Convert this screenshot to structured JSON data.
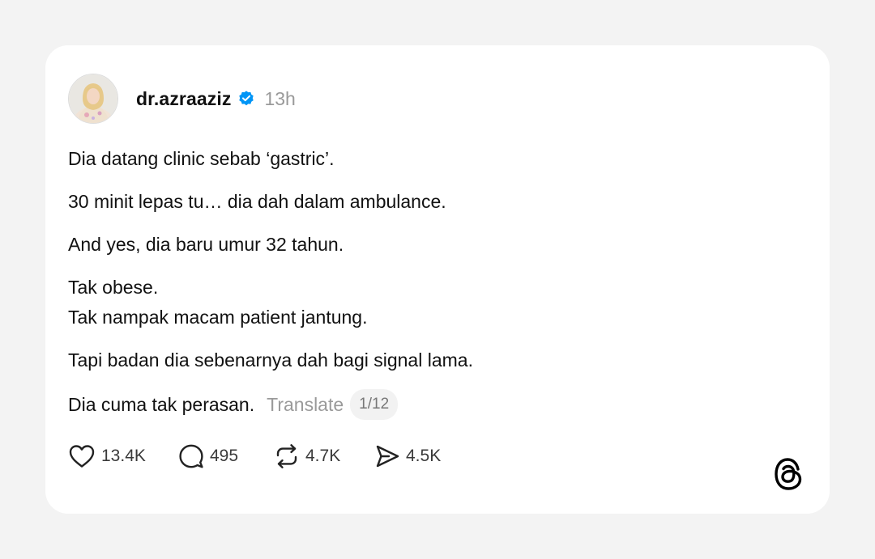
{
  "post": {
    "username": "dr.azraaziz",
    "verified": true,
    "timestamp": "13h",
    "paragraphs": [
      [
        "Dia datang clinic sebab ‘gastric’."
      ],
      [
        "30 minit lepas tu… dia dah dalam ambulance."
      ],
      [
        "And yes, dia baru umur 32 tahun."
      ],
      [
        "Tak obese.",
        "Tak nampak macam patient jantung."
      ],
      [
        "Tapi badan dia sebenarnya dah bagi signal lama."
      ]
    ],
    "last_line": "Dia cuma tak perasan.",
    "translate_label": "Translate",
    "page_indicator": "1/12"
  },
  "actions": {
    "likes": "13.4K",
    "replies": "495",
    "reposts": "4.7K",
    "shares": "4.5K"
  },
  "icons": {
    "verified": "verified-badge-icon",
    "like": "heart-icon",
    "reply": "comment-bubble-icon",
    "repost": "repost-icon",
    "share": "share-send-icon",
    "brand": "threads-logo-icon"
  },
  "colors": {
    "page_background": "#f3f3f3",
    "card_background": "#ffffff",
    "verified_blue": "#0095f6",
    "secondary_text": "#9a9a9a"
  }
}
